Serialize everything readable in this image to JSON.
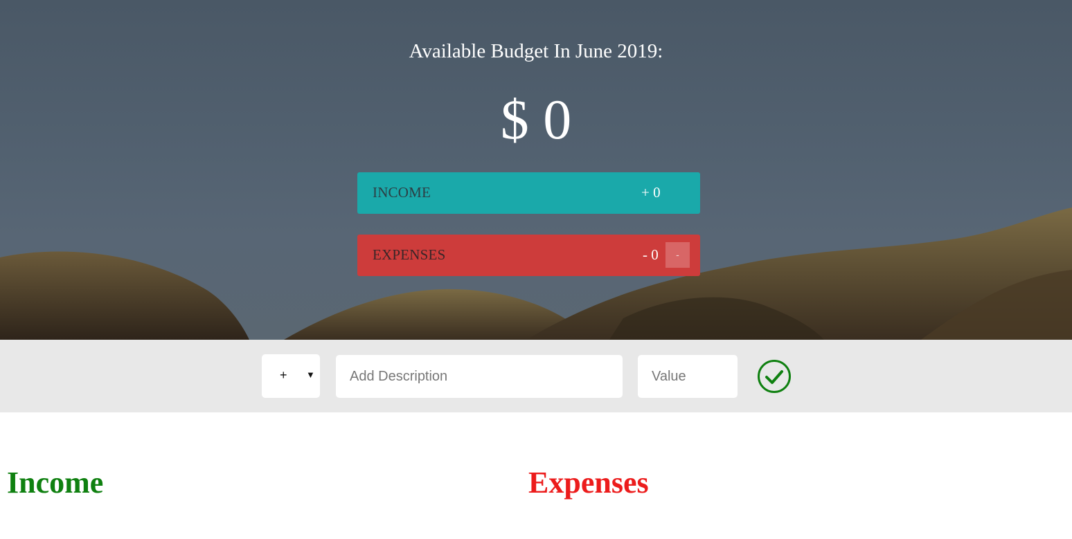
{
  "header": {
    "title": "Available Budget In June 2019:",
    "amount": "$ 0"
  },
  "summary": {
    "income": {
      "label": "INCOME",
      "value": "+ 0"
    },
    "expenses": {
      "label": "EXPENSES",
      "value": "- 0",
      "percentage": "-"
    }
  },
  "add_form": {
    "type_select": {
      "selected": "+",
      "arrow": "▼"
    },
    "description": {
      "placeholder": "Add Description",
      "value": ""
    },
    "value": {
      "placeholder": "Value",
      "value": ""
    },
    "submit_icon": "checkmark-circle-icon"
  },
  "lists": {
    "income_title": "Income",
    "expenses_title": "Expenses"
  },
  "colors": {
    "income_bar": "#1aa9aa",
    "expenses_bar": "#cd3c3b",
    "income_heading": "#0f8010",
    "expenses_heading": "#ec1c1c",
    "submit_icon": "#0f8010"
  }
}
